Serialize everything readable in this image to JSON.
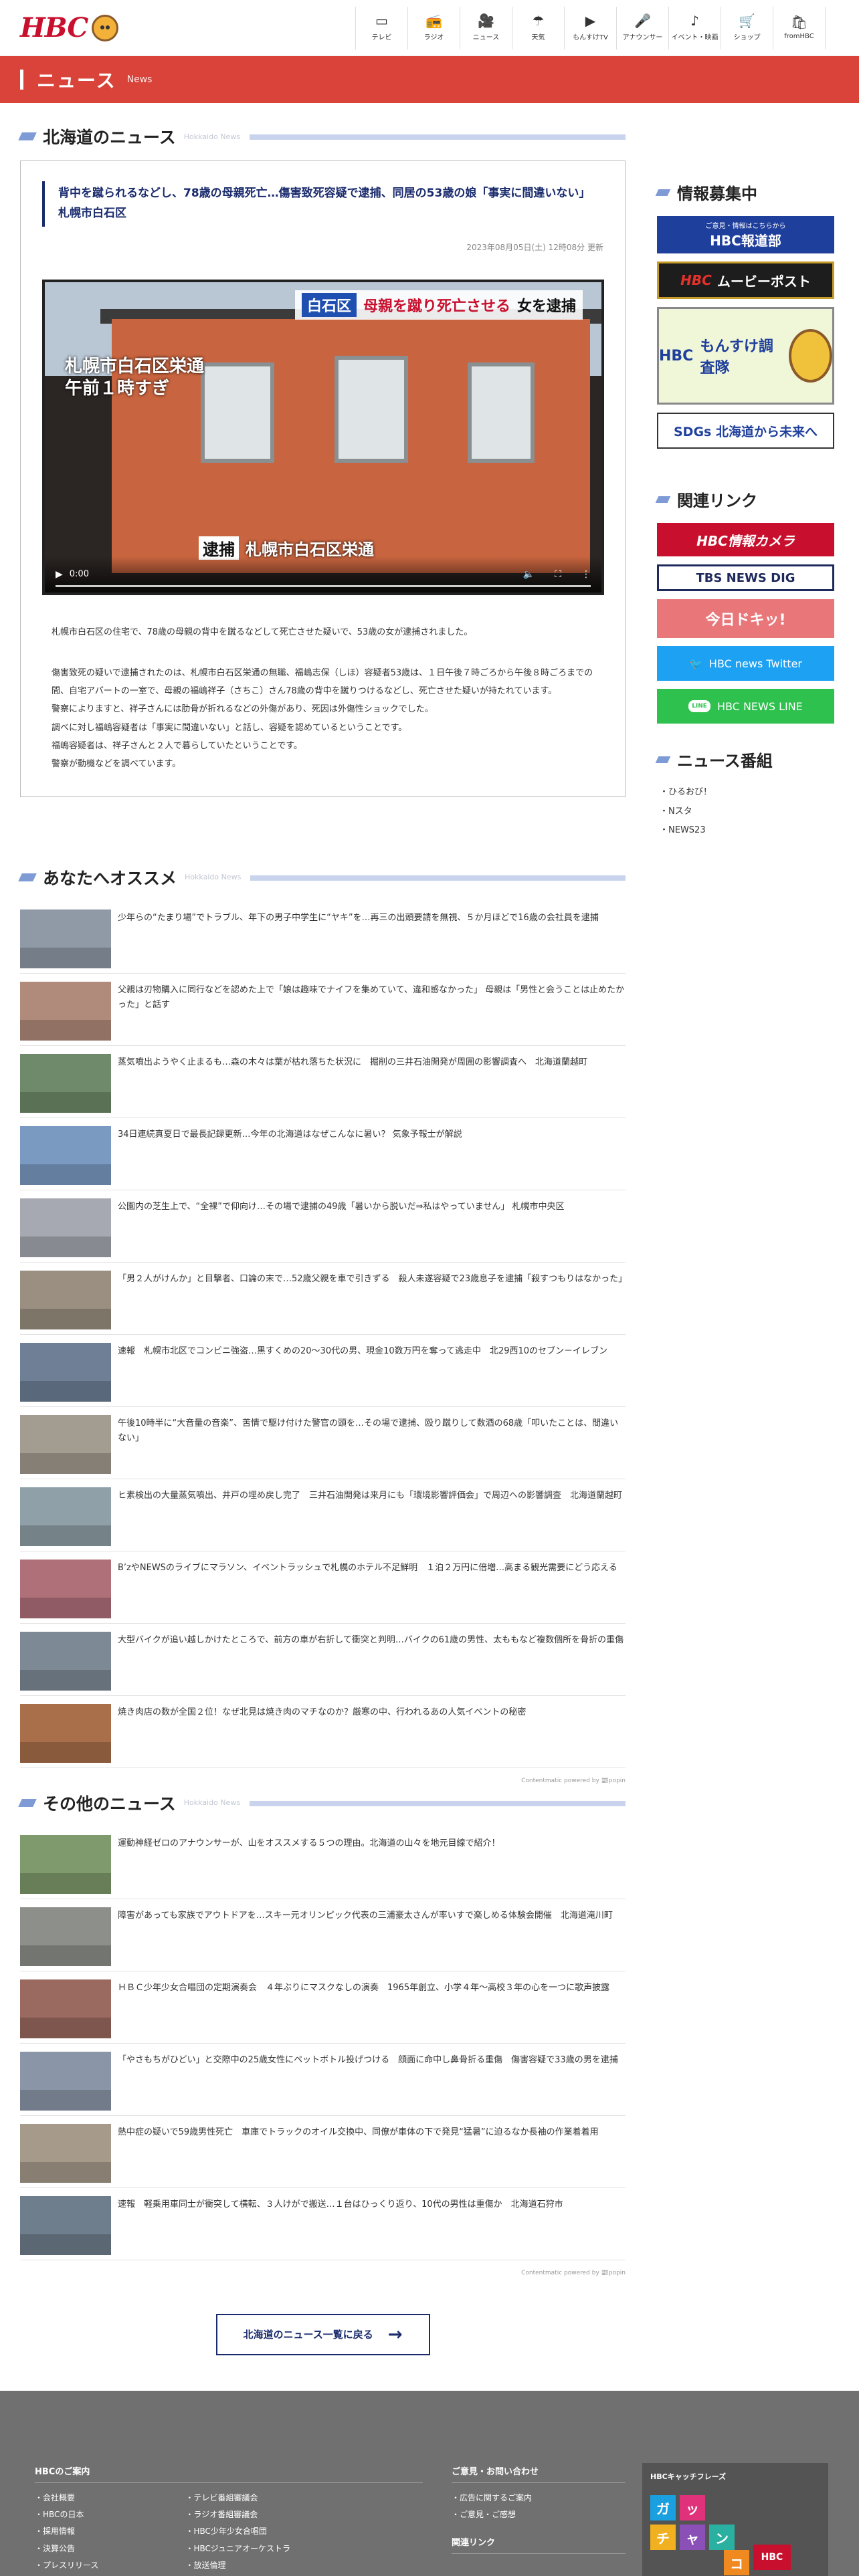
{
  "header": {
    "logo_text": "HBC",
    "nav": [
      {
        "icon": "tv-icon",
        "glyph": "▭",
        "label": "テレビ"
      },
      {
        "icon": "radio-icon",
        "glyph": "📻",
        "label": "ラジオ"
      },
      {
        "icon": "news-icon",
        "glyph": "🎥",
        "label": "ニュース"
      },
      {
        "icon": "weather-icon",
        "glyph": "☂",
        "label": "天気"
      },
      {
        "icon": "video-icon",
        "glyph": "▶",
        "label": "もんすけTV"
      },
      {
        "icon": "microphone-icon",
        "glyph": "🎤",
        "label": "アナウンサー"
      },
      {
        "icon": "music-icon",
        "glyph": "♪",
        "label": "イベント・映画"
      },
      {
        "icon": "cart-icon",
        "glyph": "🛒",
        "label": "ショップ"
      },
      {
        "icon": "bag-icon",
        "glyph": "🛍",
        "label": "fromHBC"
      }
    ]
  },
  "band": {
    "title": "ニュース",
    "sub": "News"
  },
  "hokkaido": {
    "title": "北海道のニュース",
    "sub": "Hokkaido News",
    "article": {
      "title": "背中を蹴られるなどし、78歳の母親死亡…傷害致死容疑で逮捕、同居の53歳の娘「事実に間違いない」 札幌市白石区",
      "date": "2023年08月05日(土) 12時08分 更新",
      "video": {
        "tag": "白石区",
        "headline_red": "母親を蹴り死亡させる",
        "headline_dark": "女を逮捕",
        "left_line1": "札幌市白石区栄通",
        "left_line2": "午前１時すぎ",
        "bottom_tag": "逮捕",
        "bottom_text": "札幌市白石区栄通",
        "time": "0:00"
      },
      "lead": "札幌市白石区の住宅で、78歳の母親の背中を蹴るなどして死亡させた疑いで、53歳の女が逮捕されました。",
      "paragraphs": [
        "傷害致死の疑いで逮捕されたのは、札幌市白石区栄通の無職、福嶋志保（しほ）容疑者53歳は、１日午後７時ごろから午後８時ごろまでの間、自宅アパートの一室で、母親の福嶋祥子（さちこ）さん78歳の背中を蹴りつけるなどし、死亡させた疑いが持たれています。",
        "警察によりますと、祥子さんには肋骨が折れるなどの外傷があり、死因は外傷性ショックでした。",
        "調べに対し福嶋容疑者は「事実に間違いない」と話し、容疑を認めているということです。",
        "福嶋容疑者は、祥子さんと２人で暮らしていたということです。",
        "警察が動機などを調べています。"
      ]
    }
  },
  "recommend": {
    "title": "あなたへオススメ",
    "sub": "Hokkaido News",
    "items": [
      "少年らの“たまり場”でトラブル、年下の男子中学生に“ヤキ”を…再三の出頭要請を無視、５か月ほどで16歳の会社員を逮捕",
      "父親は刃物購入に同行などを認めた上で「娘は趣味でナイフを集めていて、違和感なかった」 母親は「男性と会うことは止めたかった」と話す",
      "蒸気噴出ようやく止まるも…森の木々は葉が枯れ落ちた状況に　掘削の三井石油開発が周囲の影響調査へ　北海道蘭越町",
      "34日連続真夏日で最長記録更新…今年の北海道はなぜこんなに暑い？ 気象予報士が解説",
      "公園内の芝生上で、“全裸”で仰向け…その場で逮捕の49歳「暑いから脱いだ⇒私はやっていません」 札幌市中央区",
      "「男２人がけんか」と目撃者、口論の末で…52歳父親を車で引きずる　殺人未遂容疑で23歳息子を逮捕「殺すつもりはなかった」",
      "速報　札幌市北区でコンビニ強盗…黒すくめの20～30代の男、現金10数万円を奪って逃走中　北29西10のセブン－イレブン",
      "午後10時半に“大音量の音楽”、苦情で駆け付けた警官の頭を…その場で逮捕、殴り蹴りして数酒の68歳「叩いたことは、間違いない」",
      "ヒ素検出の大量蒸気噴出、井戸の埋め戻し完了　三井石油開発は来月にも「環境影響評価会」で周辺への影響調査　北海道蘭越町",
      "B’zやNEWSのライブにマラソン、イベントラッシュで札幌のホテル不足鮮明　１泊２万円に倍増…高まる観光需要にどう応える",
      "大型バイクが追い越しかけたところで、前方の車が右折して衝突と判明…バイクの61歳の男性、太ももなど複数個所を骨折の重傷",
      "焼き肉店の数が全国２位！なぜ北見は焼き肉のマチなのか？厳寒の中、行われるあの人気イベントの秘密"
    ],
    "powered": "Contentmatic powered by 📰popin"
  },
  "others": {
    "title": "その他のニュース",
    "sub": "Hokkaido News",
    "items": [
      "運動神経ゼロのアナウンサーが、山をオススメする５つの理由。北海道の山々を地元目線で紹介！",
      "障害があっても家族でアウトドアを…スキー元オリンピック代表の三浦豪太さんが率いすで楽しめる体験会開催　北海道滝川町",
      "ＨＢＣ少年少女合唱団の定期演奏会　４年ぶりにマスクなしの演奏　1965年創立、小学４年～高校３年の心を一つに歌声披露",
      "「やさもちがひどい」と交際中の25歳女性にペットボトル投げつける　顔面に命中し鼻骨折る重傷　傷害容疑で33歳の男を逮捕",
      "熱中症の疑いで59歳男性死亡　車庫でトラックのオイル交換中、同僚が車体の下で発見“猛暑”に迫るなか長袖の作業着着用",
      "速報　軽乗用車同士が衝突して横転、３人けがで搬送…１台はひっくり返り、10代の男性は重傷か　北海道石狩市"
    ],
    "powered": "Contentmatic powered by 📰popin",
    "more_label": "北海道のニュース一覧に戻る"
  },
  "sidebar": {
    "info_title": "情報募集中",
    "banners": {
      "camera_small": "ご意見・情報はこちらから",
      "camera": "HBC報道部",
      "movie_hbc": "HBC",
      "movie": "ムービーポスト",
      "dori_hbc": "HBC",
      "dori": "もんすけ調査隊",
      "sdgs": "SDGs 北海道から未来へ"
    },
    "links_title": "関連リンク",
    "links": {
      "hbcinfo": "HBC情報カメラ",
      "tbs": "TBS NEWS DIG",
      "kyo": "今日ドキッ!",
      "twitter": "HBC news Twitter",
      "line_badge": "LINE",
      "line": "HBC NEWS LINE"
    },
    "programs_title": "ニュース番組",
    "programs": [
      "ひるおび！",
      "Nスタ",
      "NEWS23"
    ]
  },
  "footer": {
    "company_title": "HBCのご案内",
    "company_col1": [
      "会社概要",
      "HBCの日本",
      "採用情報",
      "決算公告",
      "プレスリリース"
    ],
    "company_col2": [
      "テレビ番組審議会",
      "ラジオ番組審議会",
      "HBC少年少女合唱団",
      "HBCジュニアオーケストラ",
      "放送倫理"
    ],
    "contact_title": "ご意見・お問い合わせ",
    "contact": [
      "広告に関するご案内",
      "ご意見・ご感想"
    ],
    "related_title": "関連リンク",
    "catch_title": "HBCキャッチフレーズ",
    "catch_tiles": [
      "ガ",
      "ッ",
      "チ",
      "ャ",
      "ン",
      "コ",
      "HBC"
    ]
  }
}
